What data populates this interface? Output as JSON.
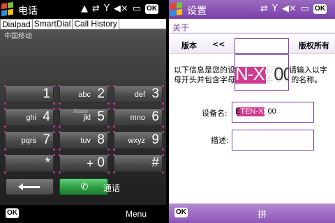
{
  "left_phone": {
    "status_bar": {
      "title": "电话",
      "icons": [
        "signal-icon",
        "sync-icon",
        "antenna-icon",
        "volume-icon",
        "battery-icon"
      ],
      "ok_label": "OK"
    },
    "tabs": [
      {
        "label": "Dialpad",
        "active": true
      },
      {
        "label": "SmartDial",
        "active": false
      },
      {
        "label": "Call History",
        "active": false
      }
    ],
    "carrier": "中国移动",
    "watermark": "Xoato",
    "keys": [
      {
        "digit": "1",
        "letters": ""
      },
      {
        "digit": "2",
        "letters": "abc"
      },
      {
        "digit": "3",
        "letters": "def"
      },
      {
        "digit": "4",
        "letters": "ghi"
      },
      {
        "digit": "5",
        "letters": "jkl"
      },
      {
        "digit": "6",
        "letters": "mno"
      },
      {
        "digit": "7",
        "letters": "pqrs"
      },
      {
        "digit": "8",
        "letters": "tuv"
      },
      {
        "digit": "9",
        "letters": "wxyz"
      },
      {
        "digit": "*",
        "letters": ""
      },
      {
        "digit": "0",
        "letters": "+"
      },
      {
        "digit": "#",
        "letters": ""
      }
    ],
    "call_label": "通话",
    "softkeys": {
      "left": "OK",
      "right": "Menu"
    },
    "colors": {
      "call_green": "#2e9d42",
      "accent_pink": "#d0309a"
    }
  },
  "right_phone": {
    "status_bar": {
      "title": "设置",
      "icons": [
        "sync-icon",
        "antenna-icon",
        "volume-icon",
        "battery-icon"
      ],
      "ok_label": "OK"
    },
    "header": "关于",
    "version_row": {
      "version": "版本",
      "back": "<<",
      "copyright": "版权所有"
    },
    "description": "以下信息是您的设备名称和标识。请输入以字母开头并包含字母 A-Z、数字 0-9 的名称。",
    "overlay_text": {
      "highlighted": "N-X9",
      "plain": "00"
    },
    "device_name": {
      "label": "设备名:",
      "value": "E",
      "highlighted": "TEN-X9",
      "rest": "00"
    },
    "description_field": {
      "label": "描述:",
      "value": ""
    },
    "softkeys": {
      "left": "OK",
      "center": "拼"
    },
    "colors": {
      "theme_purple": "#7b3fa8",
      "highlight_pink": "#d23a8f"
    }
  }
}
